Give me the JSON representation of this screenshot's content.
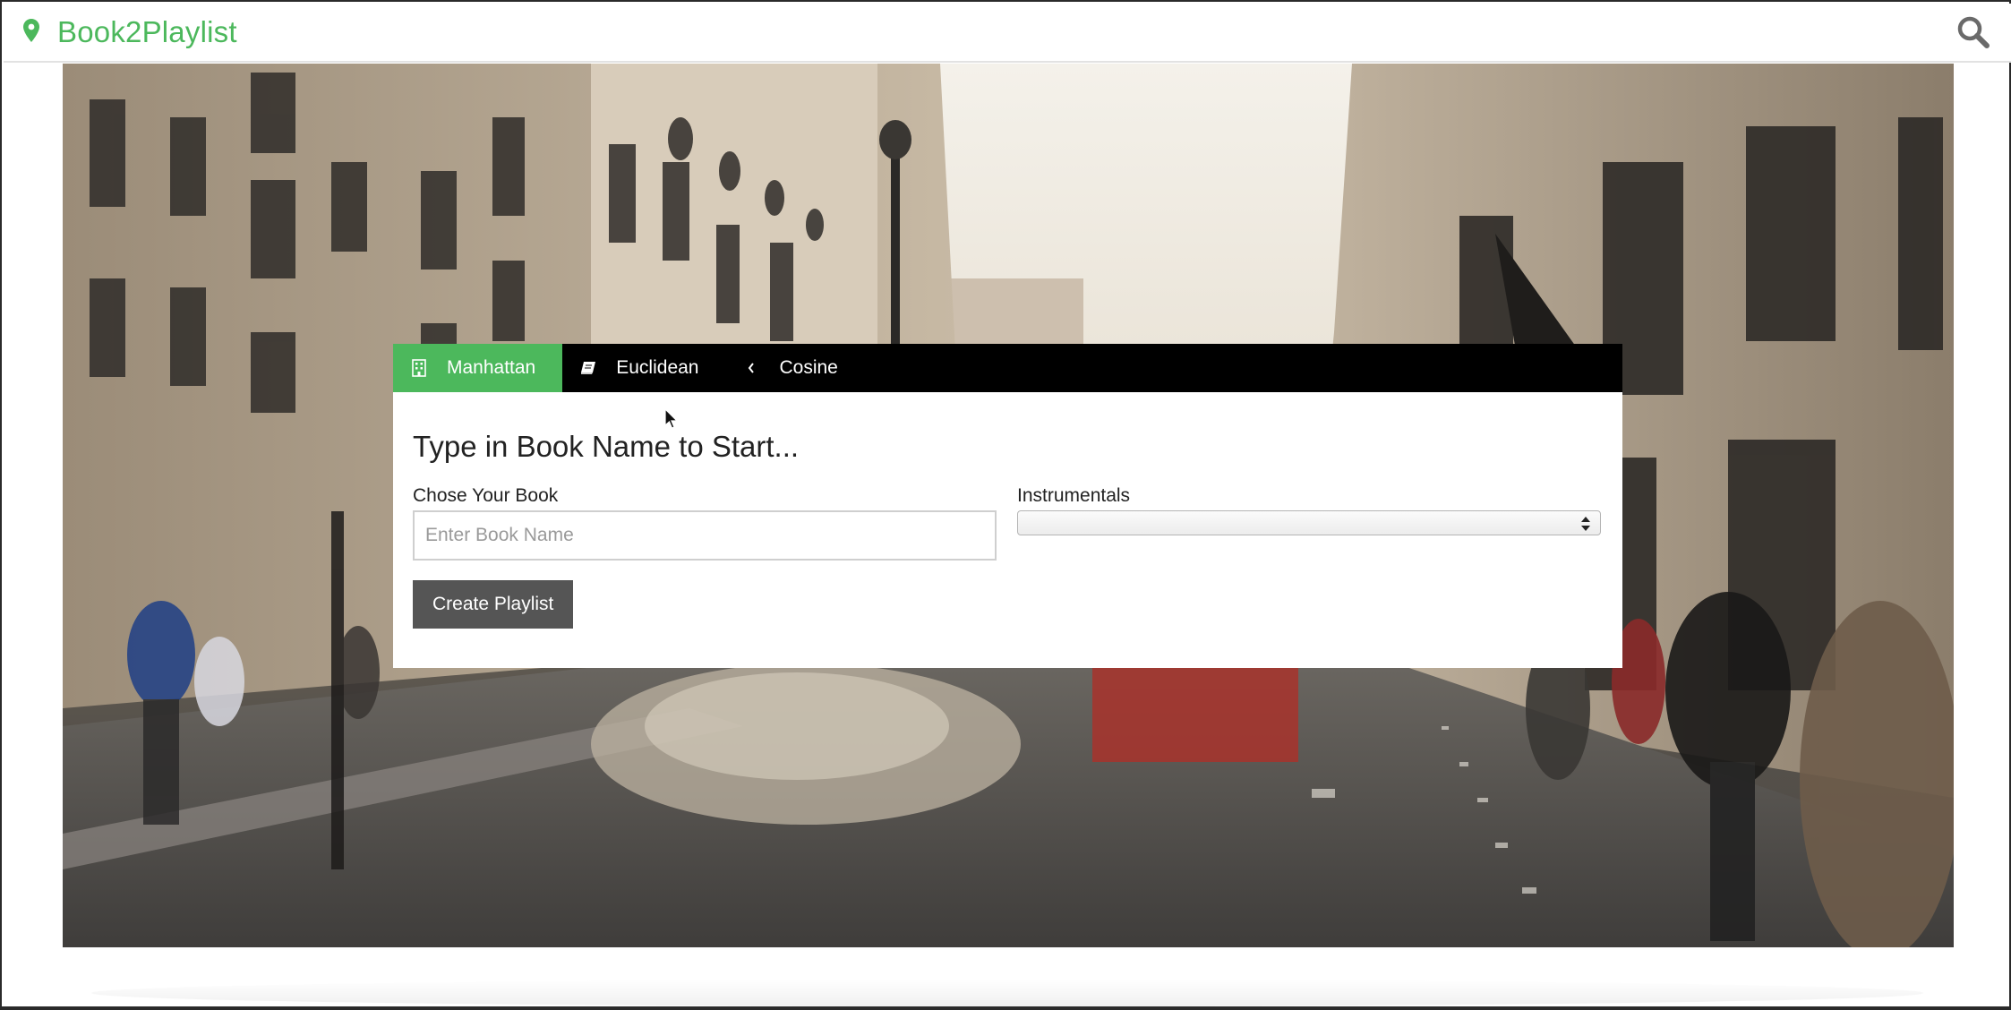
{
  "navbar": {
    "brand": "Book2Playlist",
    "brand_icon": "map-pin-icon",
    "search_icon": "search-icon"
  },
  "tabs": [
    {
      "label": "Manhattan",
      "icon": "building-icon",
      "active": true
    },
    {
      "label": "Euclidean",
      "icon": "book-icon",
      "active": false
    },
    {
      "label": "Cosine",
      "icon": "chevron-left-icon",
      "active": false
    }
  ],
  "form": {
    "heading": "Type in Book Name to Start...",
    "book_label": "Chose Your Book",
    "book_placeholder": "Enter Book Name",
    "book_value": "",
    "instr_label": "Instrumentals",
    "instr_value": "",
    "submit_label": "Create Playlist"
  },
  "colors": {
    "accent": "#4cb85c",
    "tabbar": "#000000",
    "button": "#555555"
  }
}
